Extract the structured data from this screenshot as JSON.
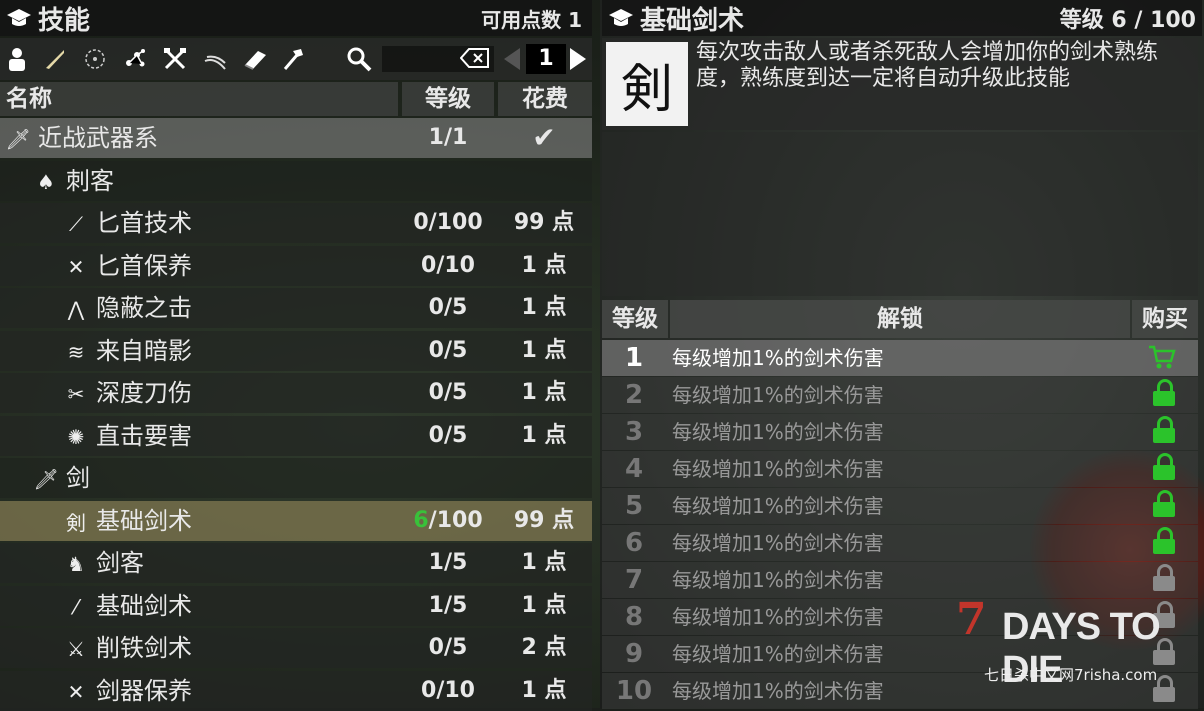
{
  "left": {
    "title": "技能",
    "points_label": "可用点数 1",
    "page_number": "1",
    "columns": {
      "name": "名称",
      "level": "等级",
      "cost": "花费"
    },
    "rows": [
      {
        "kind": "cat",
        "icon": "sword-icon",
        "name": "近战武器系",
        "level": "1/1",
        "cost": "✔"
      },
      {
        "kind": "grp",
        "icon": "assassin-icon",
        "name": "刺客",
        "level": "",
        "cost": ""
      },
      {
        "kind": "item",
        "icon": "dagger-icon",
        "name": "匕首技术",
        "level": "0/100",
        "cost": "99 点"
      },
      {
        "kind": "item",
        "icon": "crossed-daggers-icon",
        "name": "匕首保养",
        "level": "0/10",
        "cost": "1 点"
      },
      {
        "kind": "item",
        "icon": "stealth-strike-icon",
        "name": "隐蔽之击",
        "level": "0/5",
        "cost": "1 点"
      },
      {
        "kind": "item",
        "icon": "shadow-icon",
        "name": "来自暗影",
        "level": "0/5",
        "cost": "1 点"
      },
      {
        "kind": "item",
        "icon": "deep-cut-icon",
        "name": "深度刀伤",
        "level": "0/5",
        "cost": "1 点"
      },
      {
        "kind": "item",
        "icon": "vital-strike-icon",
        "name": "直击要害",
        "level": "0/5",
        "cost": "1 点"
      },
      {
        "kind": "grp",
        "icon": "sword-icon",
        "name": "剑",
        "level": "",
        "cost": ""
      },
      {
        "kind": "sel",
        "icon": "swordsmanship-icon",
        "name": "基础剑术",
        "level_highlight": "6",
        "level_rest": "/100",
        "cost": "99 点"
      },
      {
        "kind": "item",
        "icon": "swordsman-icon",
        "name": "剑客",
        "level": "1/5",
        "cost": "1 点"
      },
      {
        "kind": "item",
        "icon": "blade-icon",
        "name": "基础剑术",
        "level": "1/5",
        "cost": "1 点"
      },
      {
        "kind": "item",
        "icon": "iron-cut-icon",
        "name": "削铁剑术",
        "level": "0/5",
        "cost": "2 点"
      },
      {
        "kind": "item",
        "icon": "crossed-swords-icon",
        "name": "剑器保养",
        "level": "0/10",
        "cost": "1 点"
      }
    ]
  },
  "right": {
    "title": "基础剑术",
    "level_label": "等级 6 / 100",
    "icon_glyph": "剣",
    "description": "每次攻击敌人或者杀死敌人会增加你的剑术熟练度，熟练度到达一定将自动升级此技能",
    "columns": {
      "level": "等级",
      "unlock": "解锁",
      "buy": "购买"
    },
    "unlocks": [
      {
        "n": "1",
        "text": "每级增加1%的剑术伤害",
        "state": "cart"
      },
      {
        "n": "2",
        "text": "每级增加1%的剑术伤害",
        "state": "lock-green"
      },
      {
        "n": "3",
        "text": "每级增加1%的剑术伤害",
        "state": "lock-green"
      },
      {
        "n": "4",
        "text": "每级增加1%的剑术伤害",
        "state": "lock-green"
      },
      {
        "n": "5",
        "text": "每级增加1%的剑术伤害",
        "state": "lock-green"
      },
      {
        "n": "6",
        "text": "每级增加1%的剑术伤害",
        "state": "lock-green"
      },
      {
        "n": "7",
        "text": "每级增加1%的剑术伤害",
        "state": "lock-grey"
      },
      {
        "n": "8",
        "text": "每级增加1%的剑术伤害",
        "state": "lock-grey"
      },
      {
        "n": "9",
        "text": "每级增加1%的剑术伤害",
        "state": "lock-grey"
      },
      {
        "n": "10",
        "text": "每级增加1%的剑术伤害",
        "state": "lock-grey"
      }
    ]
  },
  "watermark": {
    "seven": "7",
    "days": "DAYS TO DIE",
    "sub": "七日杀中文网7risha.com"
  },
  "colors": {
    "accent_green": "#39c13a",
    "selected_row": "#7d7650"
  }
}
